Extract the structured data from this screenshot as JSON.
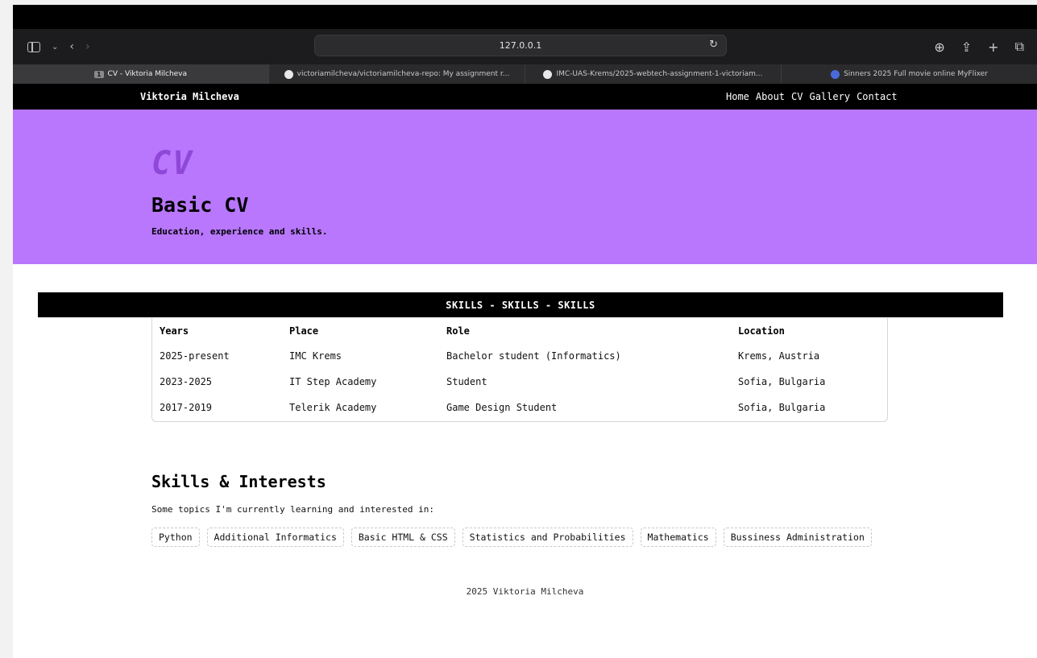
{
  "browser": {
    "url": "127.0.0.1",
    "tabs": [
      {
        "title": "CV - Viktoria Milcheva",
        "badge": "1",
        "active": true
      },
      {
        "title": "victoriamilcheva/victoriamilcheva-repo: My assignment r...",
        "icon": "github-icon"
      },
      {
        "title": "IMC-UAS-Krems/2025-webtech-assignment-1-victoriam...",
        "icon": "github-icon"
      },
      {
        "title": "Sinners 2025 Full movie online MyFlixer",
        "icon": "film-icon"
      }
    ]
  },
  "nav": {
    "brand": "Viktoria Milcheva",
    "links": [
      "Home",
      "About",
      "CV",
      "Gallery",
      "Contact"
    ]
  },
  "hero": {
    "tag": "CV",
    "title": "Basic CV",
    "subtitle": "Education, experience and skills."
  },
  "banner": "SKILLS - SKILLS - SKILLS",
  "table": {
    "headers": [
      "Years",
      "Place",
      "Role",
      "Location"
    ],
    "rows": [
      [
        "2025-present",
        "IMC Krems",
        "Bachelor student (Informatics)",
        "Krems, Austria"
      ],
      [
        "2023-2025",
        "IT Step Academy",
        "Student",
        "Sofia, Bulgaria"
      ],
      [
        "2017-2019",
        "Telerik Academy",
        "Game Design Student",
        "Sofia, Bulgaria"
      ]
    ]
  },
  "interests": {
    "title": "Skills & Interests",
    "subtitle": "Some topics I'm currently learning and interested in:",
    "chips": [
      "Python",
      "Additional Informatics",
      "Basic HTML & CSS",
      "Statistics and Probabilities",
      "Mathematics",
      "Bussiness Administration"
    ]
  },
  "footer": "2025 Viktoria Milcheva",
  "colors": {
    "hero_bg": "#b877fd",
    "hero_tag": "#8f47d8",
    "nav_bg": "#000000"
  }
}
